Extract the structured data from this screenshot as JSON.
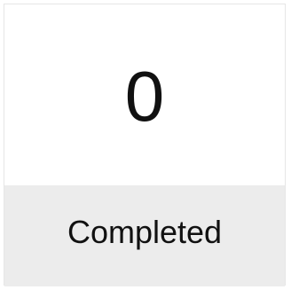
{
  "stat_card": {
    "value": "0",
    "label": "Completed",
    "colors": {
      "top_background": "#ffffff",
      "bottom_background": "#ececec",
      "border": "#e6e6e6",
      "text": "#111111"
    }
  }
}
